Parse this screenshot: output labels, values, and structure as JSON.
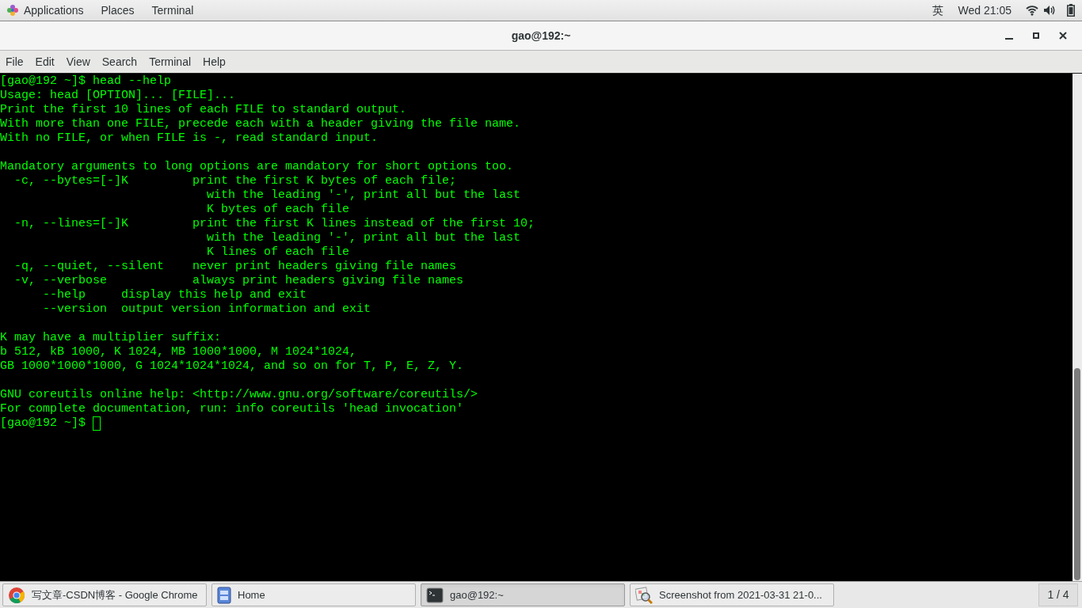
{
  "top_bar": {
    "menus": [
      "Applications",
      "Places",
      "Terminal"
    ],
    "input_method": "英",
    "clock": "Wed 21:05"
  },
  "window": {
    "title": "gao@192:~"
  },
  "menu_bar": [
    "File",
    "Edit",
    "View",
    "Search",
    "Terminal",
    "Help"
  ],
  "terminal": {
    "blocks": [
      [
        "[gao@192 ~]$ head --help",
        "Usage: head [OPTION]... [FILE]...",
        "Print the first 10 lines of each FILE to standard output.",
        "With more than one FILE, precede each with a header giving the file name.",
        "With no FILE, or when FILE is -, read standard input."
      ],
      [
        "Mandatory arguments to long options are mandatory for short options too.",
        "  -c, --bytes=[-]K         print the first K bytes of each file;",
        "                             with the leading '-', print all but the last",
        "                             K bytes of each file",
        "  -n, --lines=[-]K         print the first K lines instead of the first 10;",
        "                             with the leading '-', print all but the last",
        "                             K lines of each file",
        "  -q, --quiet, --silent    never print headers giving file names",
        "  -v, --verbose            always print headers giving file names",
        "      --help     display this help and exit",
        "      --version  output version information and exit"
      ],
      [
        "K may have a multiplier suffix:",
        "b 512, kB 1000, K 1024, MB 1000*1000, M 1024*1024,",
        "GB 1000*1000*1000, G 1024*1024*1024, and so on for T, P, E, Z, Y."
      ],
      [
        "GNU coreutils online help: <http://www.gnu.org/software/coreutils/>",
        "For complete documentation, run: info coreutils 'head invocation'"
      ]
    ],
    "prompt": "[gao@192 ~]$ "
  },
  "taskbar": {
    "items": [
      {
        "kind": "chrome",
        "label": "写文章-CSDN博客 - Google Chrome",
        "selected": false
      },
      {
        "kind": "files",
        "label": "Home",
        "selected": false
      },
      {
        "kind": "terminal",
        "label": "gao@192:~",
        "selected": true
      },
      {
        "kind": "viewer",
        "label": "Screenshot from 2021-03-31 21-0...",
        "selected": false
      }
    ],
    "workspace": "1 / 4"
  }
}
